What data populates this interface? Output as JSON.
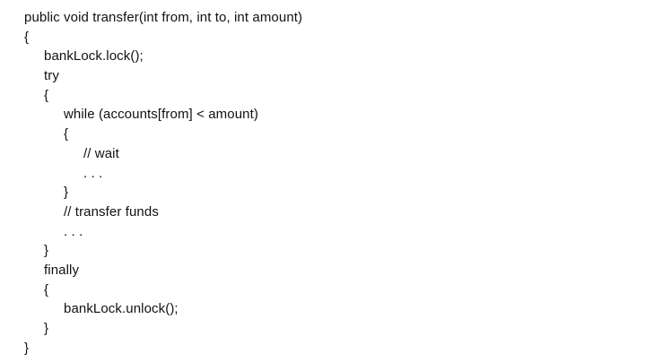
{
  "code": {
    "lines": [
      "public void transfer(int from, int to, int amount)",
      "{",
      "bankLock.lock();",
      "try",
      "{",
      "while (accounts[from] < amount)",
      "{",
      "// wait",
      ". . .",
      "}",
      "// transfer funds",
      ". . .",
      "}",
      "finally",
      "{",
      "bankLock.unlock();",
      "}",
      "}"
    ]
  }
}
